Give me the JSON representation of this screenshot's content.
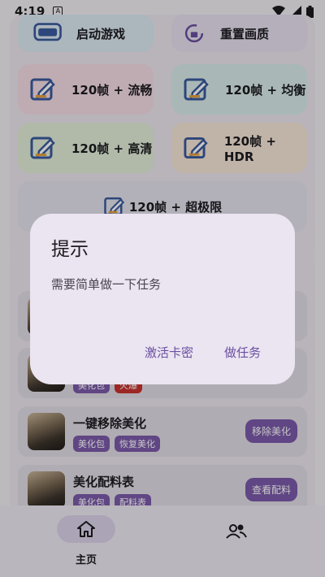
{
  "status_bar": {
    "time": "4:19",
    "notification_icon": "A"
  },
  "tiles": [
    {
      "label": "启动游戏",
      "icon": "vr-goggles-icon"
    },
    {
      "label": "重置画质",
      "icon": "reset-lock-icon"
    },
    {
      "label": "120帧 + 流畅",
      "icon": "edit-icon"
    },
    {
      "label": "120帧 + 均衡",
      "icon": "edit-icon"
    },
    {
      "label": "120帧 + 高清",
      "icon": "edit-icon"
    },
    {
      "label": "120帧 + HDR",
      "icon": "edit-icon"
    },
    {
      "label": "120帧 + 超极限",
      "icon": "edit-icon"
    }
  ],
  "list": [
    {
      "title": "",
      "tags": [],
      "action": ""
    },
    {
      "title": "",
      "tags": [
        "美化包",
        "火爆"
      ],
      "action": ""
    },
    {
      "title": "一键移除美化",
      "tags": [
        "美化包",
        "恢复美化"
      ],
      "action": "移除美化"
    },
    {
      "title": "美化配料表",
      "tags": [
        "美化包",
        "配料表"
      ],
      "action": "查看配料"
    }
  ],
  "bottom_nav": {
    "home_label": "主页"
  },
  "dialog": {
    "title": "提示",
    "message": "需要简单做一下任务",
    "btn_activate": "激活卡密",
    "btn_task": "做任务"
  },
  "colors": {
    "accent": "#7b5aa9",
    "dialog_bg": "#ebe4f1",
    "hot_tag": "#c8322f"
  }
}
